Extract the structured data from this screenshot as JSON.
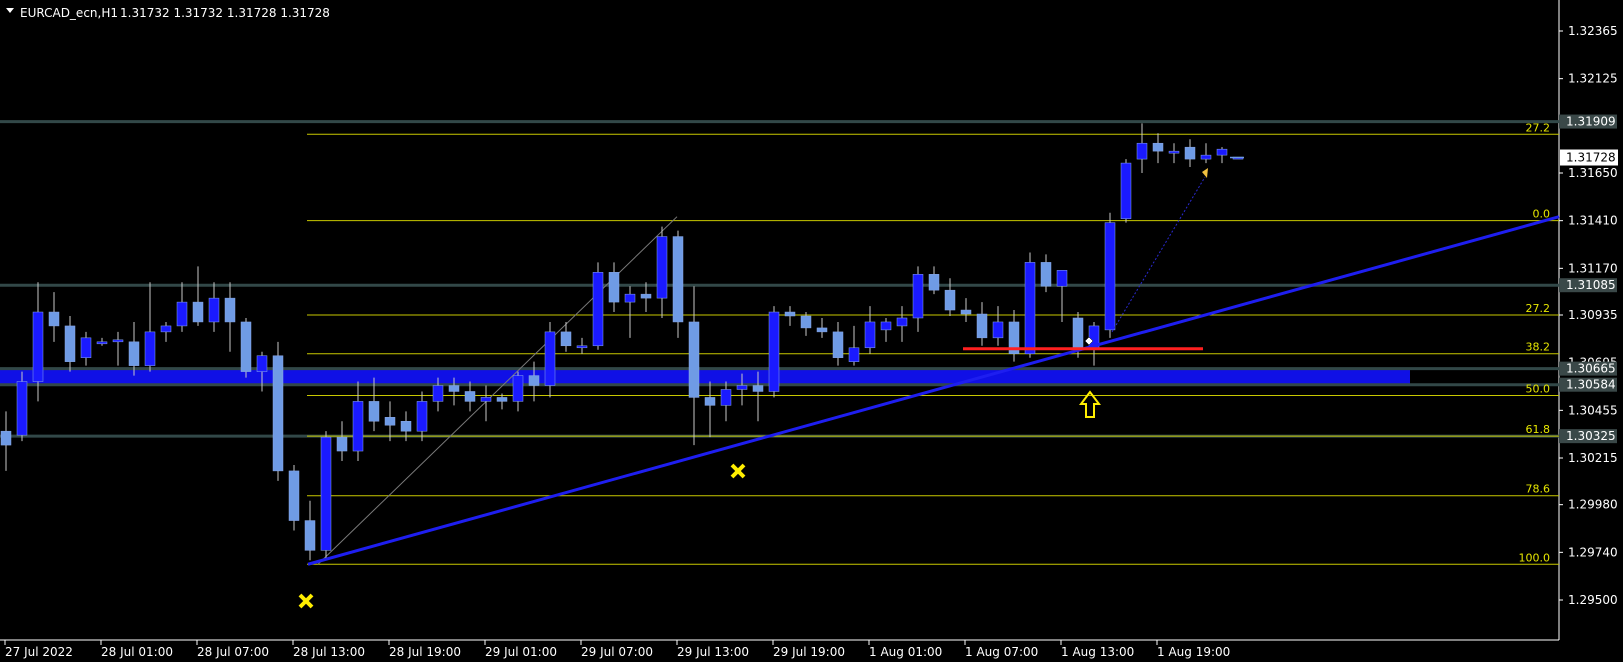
{
  "window": {
    "symbol": "EURCAD_ecn,H1",
    "ohlc": "1.31732 1.31732 1.31728 1.31728"
  },
  "price_axis": {
    "ticks": [
      "1.32365",
      "1.32125",
      "1.31650",
      "1.31410",
      "1.31170",
      "1.30935",
      "1.30695",
      "1.30455",
      "1.30215",
      "1.29980",
      "1.29740",
      "1.29500"
    ],
    "current_price": "1.31728",
    "level_tags": [
      "1.31909",
      "1.31085",
      "1.30665",
      "1.30584",
      "1.30325"
    ]
  },
  "time_axis": {
    "labels": [
      "27 Jul 2022",
      "28 Jul 01:00",
      "28 Jul 07:00",
      "28 Jul 13:00",
      "28 Jul 19:00",
      "29 Jul 01:00",
      "29 Jul 07:00",
      "29 Jul 13:00",
      "29 Jul 19:00",
      "1 Aug 01:00",
      "1 Aug 07:00",
      "1 Aug 13:00",
      "1 Aug 19:00"
    ]
  },
  "fibonacci": {
    "levels": [
      "61.8",
      "27.2",
      "0.0",
      "27.2",
      "38.2",
      "50.0",
      "61.8",
      "78.6",
      "100.0"
    ]
  },
  "colors": {
    "background": "#000000",
    "bull_candle": "#1a1aff",
    "bear_candle": "#6f9be5",
    "wick": "#c8c8c8",
    "fib": "#c8c800",
    "trendline": "#1e1ef0",
    "zone": "#1010e6",
    "sr_line": "#324848",
    "red_line": "#ff2020",
    "marker": "#ffee00"
  },
  "chart_data": {
    "type": "candlestick",
    "title": "EURCAD_ecn,H1",
    "ylim": [
      1.2938,
      1.3253
    ],
    "candles": [
      {
        "o": 1.3035,
        "h": 1.3045,
        "l": 1.3015,
        "c": 1.3028
      },
      {
        "o": 1.3033,
        "h": 1.3065,
        "l": 1.303,
        "c": 1.306
      },
      {
        "o": 1.306,
        "h": 1.311,
        "l": 1.305,
        "c": 1.3095
      },
      {
        "o": 1.3095,
        "h": 1.3105,
        "l": 1.308,
        "c": 1.3088
      },
      {
        "o": 1.3088,
        "h": 1.3093,
        "l": 1.3065,
        "c": 1.307
      },
      {
        "o": 1.3072,
        "h": 1.3085,
        "l": 1.3068,
        "c": 1.3082
      },
      {
        "o": 1.308,
        "h": 1.3082,
        "l": 1.3078,
        "c": 1.308
      },
      {
        "o": 1.308,
        "h": 1.3085,
        "l": 1.3068,
        "c": 1.3081
      },
      {
        "o": 1.308,
        "h": 1.309,
        "l": 1.3063,
        "c": 1.3068
      },
      {
        "o": 1.3068,
        "h": 1.311,
        "l": 1.3065,
        "c": 1.3085
      },
      {
        "o": 1.3085,
        "h": 1.309,
        "l": 1.308,
        "c": 1.3088
      },
      {
        "o": 1.3088,
        "h": 1.311,
        "l": 1.3085,
        "c": 1.31
      },
      {
        "o": 1.31,
        "h": 1.3118,
        "l": 1.3088,
        "c": 1.309
      },
      {
        "o": 1.309,
        "h": 1.311,
        "l": 1.3085,
        "c": 1.3102
      },
      {
        "o": 1.3102,
        "h": 1.311,
        "l": 1.3075,
        "c": 1.309
      },
      {
        "o": 1.309,
        "h": 1.3092,
        "l": 1.3062,
        "c": 1.3065
      },
      {
        "o": 1.3065,
        "h": 1.3075,
        "l": 1.3055,
        "c": 1.3073
      },
      {
        "o": 1.3073,
        "h": 1.308,
        "l": 1.301,
        "c": 1.3015
      },
      {
        "o": 1.3015,
        "h": 1.3018,
        "l": 1.2985,
        "c": 1.299
      },
      {
        "o": 1.299,
        "h": 1.3,
        "l": 1.297,
        "c": 1.2975
      },
      {
        "o": 1.2975,
        "h": 1.3035,
        "l": 1.297,
        "c": 1.3032
      },
      {
        "o": 1.3032,
        "h": 1.304,
        "l": 1.302,
        "c": 1.3025
      },
      {
        "o": 1.3025,
        "h": 1.306,
        "l": 1.302,
        "c": 1.305
      },
      {
        "o": 1.305,
        "h": 1.3062,
        "l": 1.3035,
        "c": 1.304
      },
      {
        "o": 1.3042,
        "h": 1.305,
        "l": 1.303,
        "c": 1.3038
      },
      {
        "o": 1.304,
        "h": 1.3045,
        "l": 1.303,
        "c": 1.3035
      },
      {
        "o": 1.3035,
        "h": 1.3055,
        "l": 1.303,
        "c": 1.305
      },
      {
        "o": 1.305,
        "h": 1.3062,
        "l": 1.3045,
        "c": 1.3058
      },
      {
        "o": 1.3058,
        "h": 1.3062,
        "l": 1.3048,
        "c": 1.3055
      },
      {
        "o": 1.3055,
        "h": 1.306,
        "l": 1.3045,
        "c": 1.305
      },
      {
        "o": 1.305,
        "h": 1.3058,
        "l": 1.304,
        "c": 1.3052
      },
      {
        "o": 1.3052,
        "h": 1.3054,
        "l": 1.3046,
        "c": 1.305
      },
      {
        "o": 1.305,
        "h": 1.3065,
        "l": 1.3045,
        "c": 1.3063
      },
      {
        "o": 1.3063,
        "h": 1.307,
        "l": 1.305,
        "c": 1.3058
      },
      {
        "o": 1.3058,
        "h": 1.309,
        "l": 1.3052,
        "c": 1.3085
      },
      {
        "o": 1.3085,
        "h": 1.309,
        "l": 1.3075,
        "c": 1.3078
      },
      {
        "o": 1.3078,
        "h": 1.3082,
        "l": 1.3074,
        "c": 1.3078
      },
      {
        "o": 1.3078,
        "h": 1.312,
        "l": 1.3076,
        "c": 1.3115
      },
      {
        "o": 1.3115,
        "h": 1.312,
        "l": 1.3095,
        "c": 1.31
      },
      {
        "o": 1.31,
        "h": 1.3108,
        "l": 1.3082,
        "c": 1.3104
      },
      {
        "o": 1.3104,
        "h": 1.311,
        "l": 1.3095,
        "c": 1.3102
      },
      {
        "o": 1.3102,
        "h": 1.3138,
        "l": 1.3092,
        "c": 1.3133
      },
      {
        "o": 1.3133,
        "h": 1.3136,
        "l": 1.3082,
        "c": 1.309
      },
      {
        "o": 1.309,
        "h": 1.3108,
        "l": 1.3028,
        "c": 1.3052
      },
      {
        "o": 1.3052,
        "h": 1.306,
        "l": 1.3032,
        "c": 1.3048
      },
      {
        "o": 1.3048,
        "h": 1.306,
        "l": 1.304,
        "c": 1.3056
      },
      {
        "o": 1.3056,
        "h": 1.3064,
        "l": 1.3048,
        "c": 1.3058
      },
      {
        "o": 1.3058,
        "h": 1.3065,
        "l": 1.304,
        "c": 1.3055
      },
      {
        "o": 1.3055,
        "h": 1.3098,
        "l": 1.3052,
        "c": 1.3095
      },
      {
        "o": 1.3095,
        "h": 1.3098,
        "l": 1.3088,
        "c": 1.3093
      },
      {
        "o": 1.3093,
        "h": 1.3095,
        "l": 1.3083,
        "c": 1.3087
      },
      {
        "o": 1.3087,
        "h": 1.3092,
        "l": 1.3082,
        "c": 1.3085
      },
      {
        "o": 1.3085,
        "h": 1.309,
        "l": 1.3068,
        "c": 1.3072
      },
      {
        "o": 1.307,
        "h": 1.3088,
        "l": 1.3068,
        "c": 1.3077
      },
      {
        "o": 1.3077,
        "h": 1.3098,
        "l": 1.3074,
        "c": 1.309
      },
      {
        "o": 1.3086,
        "h": 1.3092,
        "l": 1.308,
        "c": 1.309
      },
      {
        "o": 1.3088,
        "h": 1.3098,
        "l": 1.308,
        "c": 1.3092
      },
      {
        "o": 1.3092,
        "h": 1.3118,
        "l": 1.3085,
        "c": 1.3114
      },
      {
        "o": 1.3114,
        "h": 1.3118,
        "l": 1.3104,
        "c": 1.3106
      },
      {
        "o": 1.3106,
        "h": 1.3112,
        "l": 1.3093,
        "c": 1.3096
      },
      {
        "o": 1.3096,
        "h": 1.3102,
        "l": 1.309,
        "c": 1.3094
      },
      {
        "o": 1.3094,
        "h": 1.31,
        "l": 1.3078,
        "c": 1.3082
      },
      {
        "o": 1.3082,
        "h": 1.3098,
        "l": 1.3078,
        "c": 1.309
      },
      {
        "o": 1.309,
        "h": 1.3096,
        "l": 1.307,
        "c": 1.3074
      },
      {
        "o": 1.3074,
        "h": 1.3125,
        "l": 1.3072,
        "c": 1.312
      },
      {
        "o": 1.312,
        "h": 1.3124,
        "l": 1.3105,
        "c": 1.3108
      },
      {
        "o": 1.3108,
        "h": 1.3116,
        "l": 1.309,
        "c": 1.3116
      },
      {
        "o": 1.3092,
        "h": 1.3095,
        "l": 1.3072,
        "c": 1.3076
      },
      {
        "o": 1.3076,
        "h": 1.309,
        "l": 1.3068,
        "c": 1.3088
      },
      {
        "o": 1.3086,
        "h": 1.3145,
        "l": 1.3082,
        "c": 1.314
      },
      {
        "o": 1.3142,
        "h": 1.3172,
        "l": 1.314,
        "c": 1.317
      },
      {
        "o": 1.3172,
        "h": 1.319,
        "l": 1.3165,
        "c": 1.318
      },
      {
        "o": 1.318,
        "h": 1.3185,
        "l": 1.317,
        "c": 1.3176
      },
      {
        "o": 1.3176,
        "h": 1.318,
        "l": 1.317,
        "c": 1.3176
      },
      {
        "o": 1.3178,
        "h": 1.3182,
        "l": 1.3168,
        "c": 1.3172
      },
      {
        "o": 1.3172,
        "h": 1.318,
        "l": 1.317,
        "c": 1.3174
      },
      {
        "o": 1.3174,
        "h": 1.3178,
        "l": 1.317,
        "c": 1.3177
      },
      {
        "o": 1.3173,
        "h": 1.3173,
        "l": 1.3173,
        "c": 1.3173
      }
    ]
  }
}
